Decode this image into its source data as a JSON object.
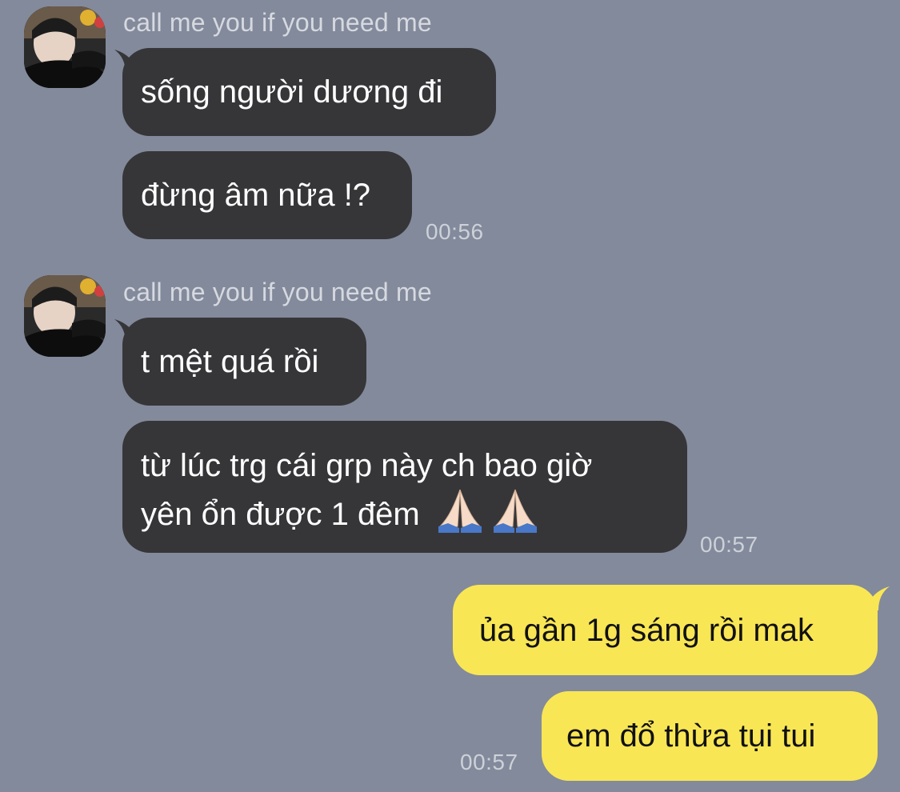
{
  "conversation": {
    "groups": [
      {
        "sender": "call me you if you need me",
        "messages": [
          "sống người dương đi",
          "đừng âm nữa !?"
        ],
        "time": "00:56"
      },
      {
        "sender": "call me you if you need me",
        "messages": [
          "t mệt quá rồi",
          "từ lúc trg cái grp này ch bao giờ",
          "yên ổn được 1 đêm"
        ],
        "time": "00:57"
      }
    ],
    "outgoing": {
      "messages": [
        "ủa gần 1g sáng rồi mak",
        "em đổ thừa tụi tui"
      ],
      "time": "00:57"
    }
  },
  "icons": {
    "praying_hands": "praying-hands-emoji",
    "avatar": "profile-avatar"
  },
  "colors": {
    "background": "#838a9b",
    "incoming_bubble": "#363639",
    "outgoing_bubble": "#f9e655",
    "timestamp": "#cdd1d9",
    "sender_name": "#d6d9e0"
  }
}
